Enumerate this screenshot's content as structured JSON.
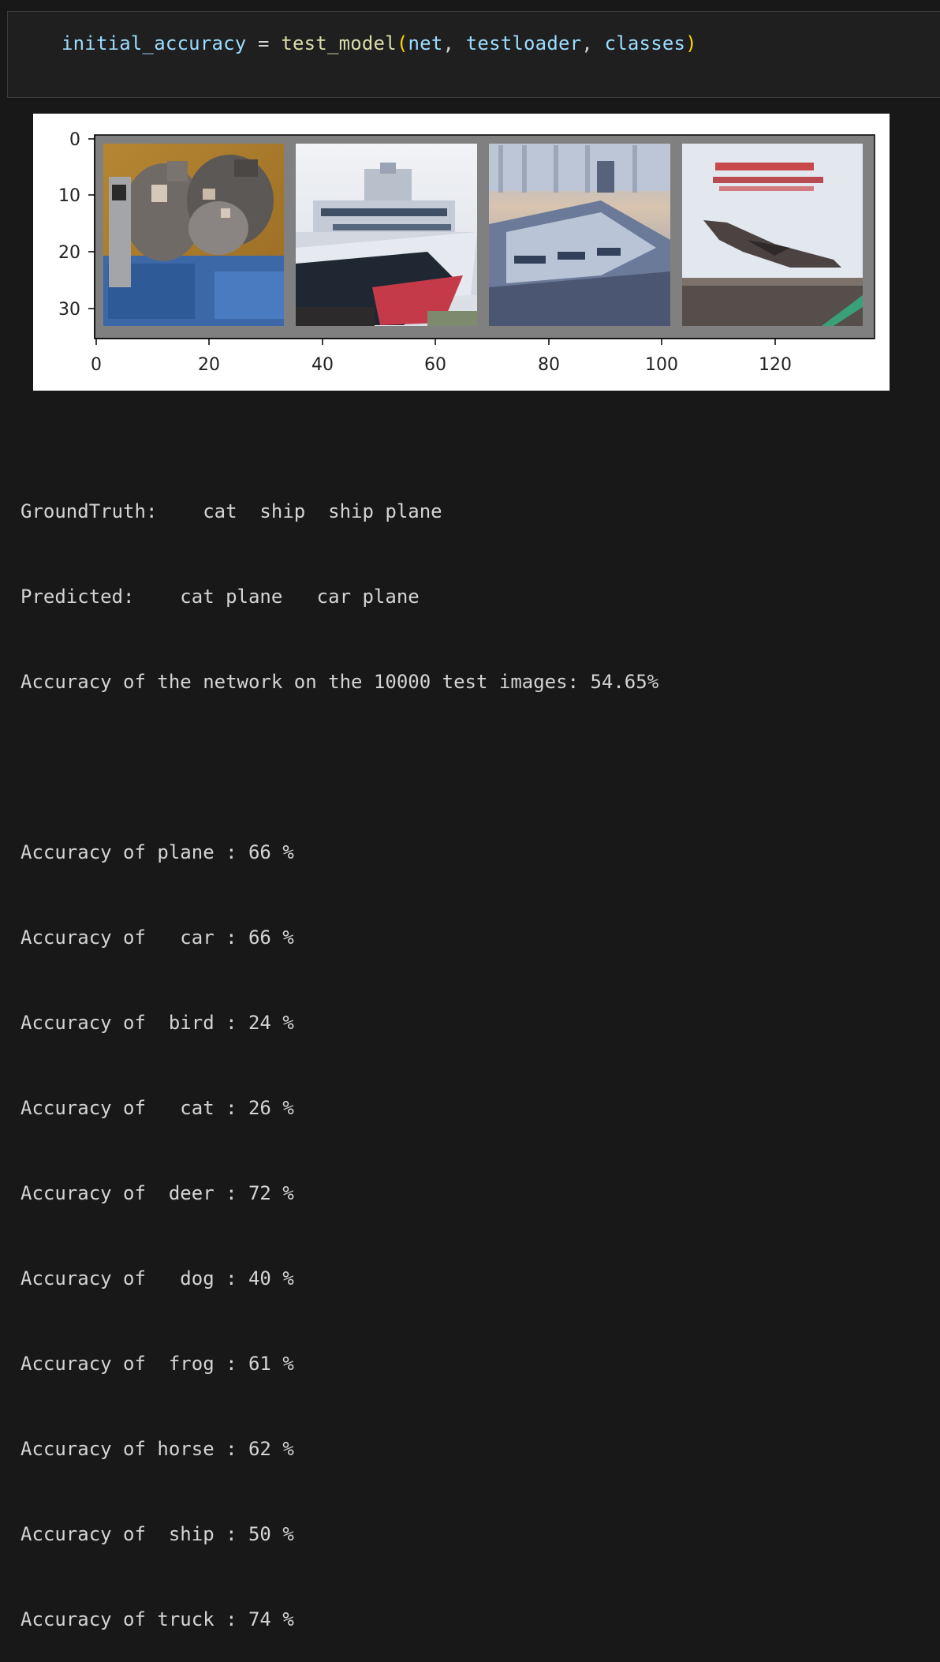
{
  "code_cell": {
    "assign_var": "initial_accuracy",
    "equals": "=",
    "func": "test_model",
    "args": [
      "net",
      "testloader",
      "classes"
    ]
  },
  "plot": {
    "y_ticks": [
      "0",
      "10",
      "20",
      "30"
    ],
    "x_ticks": [
      "0",
      "20",
      "40",
      "60",
      "80",
      "100",
      "120"
    ],
    "images": [
      {
        "name": "cat-image",
        "label": "cat"
      },
      {
        "name": "ship-image-1",
        "label": "ship"
      },
      {
        "name": "ship-image-2",
        "label": "ship"
      },
      {
        "name": "plane-image",
        "label": "plane"
      }
    ],
    "colors": {
      "frame": "#808080",
      "cat_bg": "#b07e2c",
      "sky": "#e4e8ee",
      "hull_dark": "#1f2733",
      "hull_red": "#c43a48",
      "water": "#5e6e8e",
      "plane_bg": "#dde2ea"
    }
  },
  "output": {
    "ground_truth": "GroundTruth:    cat  ship  ship plane",
    "predicted": "Predicted:    cat plane   car plane",
    "overall": "Accuracy of the network on the 10000 test images: 54.65%",
    "per_class": [
      "Accuracy of plane : 66 %",
      "Accuracy of   car : 66 %",
      "Accuracy of  bird : 24 %",
      "Accuracy of   cat : 26 %",
      "Accuracy of  deer : 72 %",
      "Accuracy of   dog : 40 %",
      "Accuracy of  frog : 61 %",
      "Accuracy of horse : 62 %",
      "Accuracy of  ship : 50 %",
      "Accuracy of truck : 74 %"
    ]
  }
}
